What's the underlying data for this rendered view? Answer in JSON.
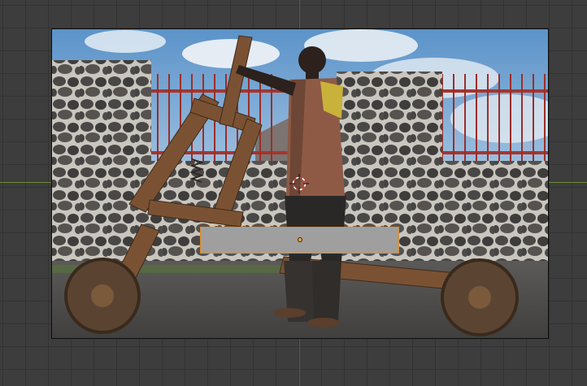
{
  "viewport": {
    "background": "#3d3d3d",
    "grid_color": "#333333",
    "x_axis_color": "#6f8a3a",
    "y_axis_color": "#3f5f8a"
  },
  "image_plane": {
    "content": "photo",
    "selected": false
  },
  "selected_object": {
    "type": "plane",
    "fill": "#9f9f9f",
    "outline_color": "#e58a1f",
    "origin_color": "#f0a33a"
  },
  "cursor_3d": {
    "icon": "3d-cursor-icon",
    "colors": [
      "#e03a3a",
      "#ffffff"
    ]
  }
}
